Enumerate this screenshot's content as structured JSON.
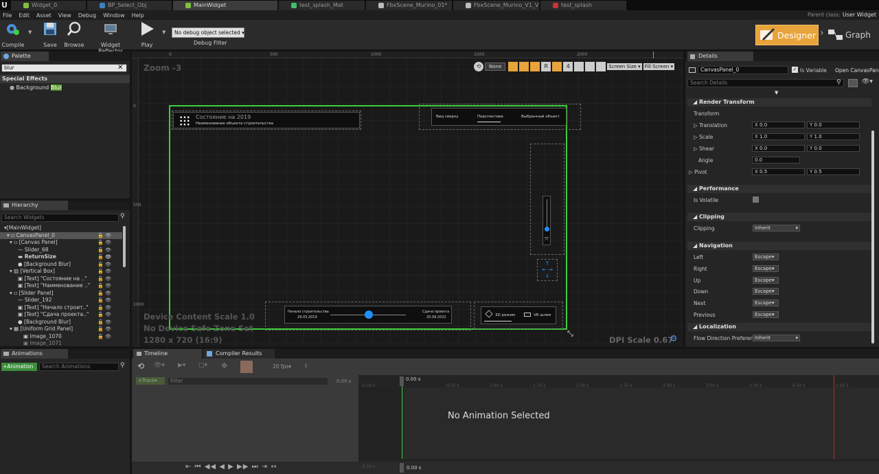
{
  "tabs": [
    "Widget_0",
    "BP_Select_Obj",
    "MainWidget",
    "test_splash_Mat",
    "FbxScene_Murino_01*",
    "FbxScene_Murino_V1_V2*",
    "test_splash"
  ],
  "parent_class_label": "Parent class:",
  "parent_class_value": "User Widget",
  "menu": [
    "File",
    "Edit",
    "Asset",
    "View",
    "Debug",
    "Window",
    "Help"
  ],
  "toolbar": {
    "compile": "Compile",
    "save": "Save",
    "browse": "Browse",
    "reflector": "Widget Reflector",
    "play": "Play",
    "debug_select": "No debug object selected",
    "debug_filter": "Debug Filter"
  },
  "mode": {
    "designer": "Designer",
    "graph": "Graph"
  },
  "palette": {
    "tab": "Palette",
    "search": "blur",
    "category": "Special Effects",
    "item_prefix": "Background ",
    "item_highlight": "Blur"
  },
  "hierarchy": {
    "tab": "Hierarchy",
    "search_placeholder": "Search Widgets",
    "items": [
      "[MainWidget]",
      "CanvasPanel_0",
      "[Canvas Panel]",
      "Slider_68",
      "ReturnSize",
      "[Background Blur]",
      "[Vertical Box]",
      "[Text] \"Состояние на ..\"",
      "[Text] \"Наименование ..\"",
      "[Slider Panel]",
      "Slider_192",
      "[Text] \"Начало строит..\"",
      "[Text] \"Сдача проекта..\"",
      "[Background Blur]",
      "[Uniform Grid Panel]",
      "Image_1070",
      "Image_1071"
    ]
  },
  "designer": {
    "zoom": "Zoom -3",
    "ruler": [
      "0",
      "500",
      "1000",
      "1500",
      "2000"
    ],
    "vruler": [
      "0",
      "500",
      "1000"
    ],
    "none_btn": "None",
    "r_btn": "R",
    "four_btn": "4",
    "screen_size": "Screen Size",
    "fill_screen": "Fill Screen",
    "device_scale": "Device Content Scale 1.0",
    "safe_zone": "No Device Safe Zone Set",
    "resolution": "1280 x 720 (16:9)",
    "dpi": "DPI Scale 0.67"
  },
  "preview": {
    "title": "Состояние на 2019",
    "subtitle": "Наименование объекта строительства",
    "views": [
      "Вид сверху",
      "Перспектива",
      "Выбранный объект"
    ],
    "start_label": "Начало строительства",
    "start_date": "29.03.2019",
    "end_label": "Сдача проекта",
    "end_date": "20.09.2022",
    "mode_3d": "3D режим",
    "mode_vr": "VR шлем"
  },
  "details": {
    "tab": "Details",
    "name": "CanvasPanel_0",
    "is_variable": "Is Variable",
    "open": "Open CanvasPan",
    "search_placeholder": "Search Details",
    "render_transform": "Render Transform",
    "transform": "Transform",
    "translation": "Translation",
    "scale": "Scale",
    "shear": "Shear",
    "angle": "Angle",
    "pivot": "Pivot",
    "tx": "0.0",
    "ty": "0.0",
    "sx": "1.0",
    "sy": "1.0",
    "shx": "0.0",
    "shy": "0.0",
    "angle_v": "0.0",
    "px": "0.5",
    "py": "0.5",
    "performance": "Performance",
    "is_volatile": "Is Volatile",
    "clipping_sec": "Clipping",
    "clipping": "Clipping",
    "clipping_v": "Inherit",
    "navigation": "Navigation",
    "nav": [
      "Left",
      "Right",
      "Up",
      "Down",
      "Next",
      "Previous"
    ],
    "nav_v": "Escape",
    "localization": "Localization",
    "flow": "Flow Direction Preferenc",
    "flow_v": "Inherit"
  },
  "animations": {
    "tab": "Animations",
    "add": "+Animation",
    "search_placeholder": "Search Animations"
  },
  "timeline": {
    "tab1": "Timeline",
    "tab2": "Compiler Results",
    "fps": "20 fps",
    "track": "+Track",
    "filter": "Filter",
    "time0": "0.00 s",
    "ticks": [
      "0.50 s",
      "1.00 s",
      "1.50 s",
      "2.00 s",
      "2.50 s",
      "3.00 s",
      "3.50 s",
      "4.00 s",
      "4.50 s",
      "5.00 s"
    ],
    "neg": "-0.50 s",
    "no_anim": "No Animation Selected"
  },
  "colors": {
    "accent": "#e8a33a",
    "green": "#3bd13b",
    "blue": "#1e90ff"
  }
}
